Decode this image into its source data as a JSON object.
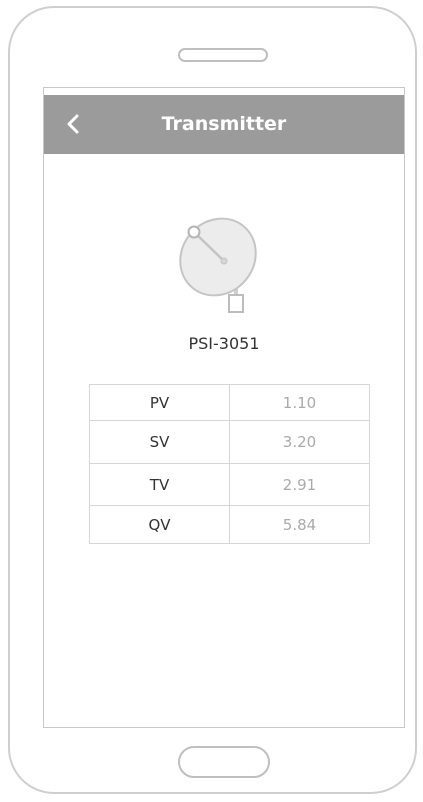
{
  "header": {
    "title": "Transmitter",
    "back_icon": "chevron-left-icon"
  },
  "device": {
    "icon": "satellite-dish-icon",
    "name": "PSI-3051"
  },
  "variables": [
    {
      "label": "PV",
      "value": "1.10"
    },
    {
      "label": "SV",
      "value": "3.20"
    },
    {
      "label": "TV",
      "value": "2.91"
    },
    {
      "label": "QV",
      "value": "5.84"
    }
  ],
  "colors": {
    "app_bar": "#9b9b9b",
    "title_text": "#ffffff",
    "value_text": "#aaaaaa",
    "label_text": "#333333",
    "border": "#d6d6d6"
  }
}
